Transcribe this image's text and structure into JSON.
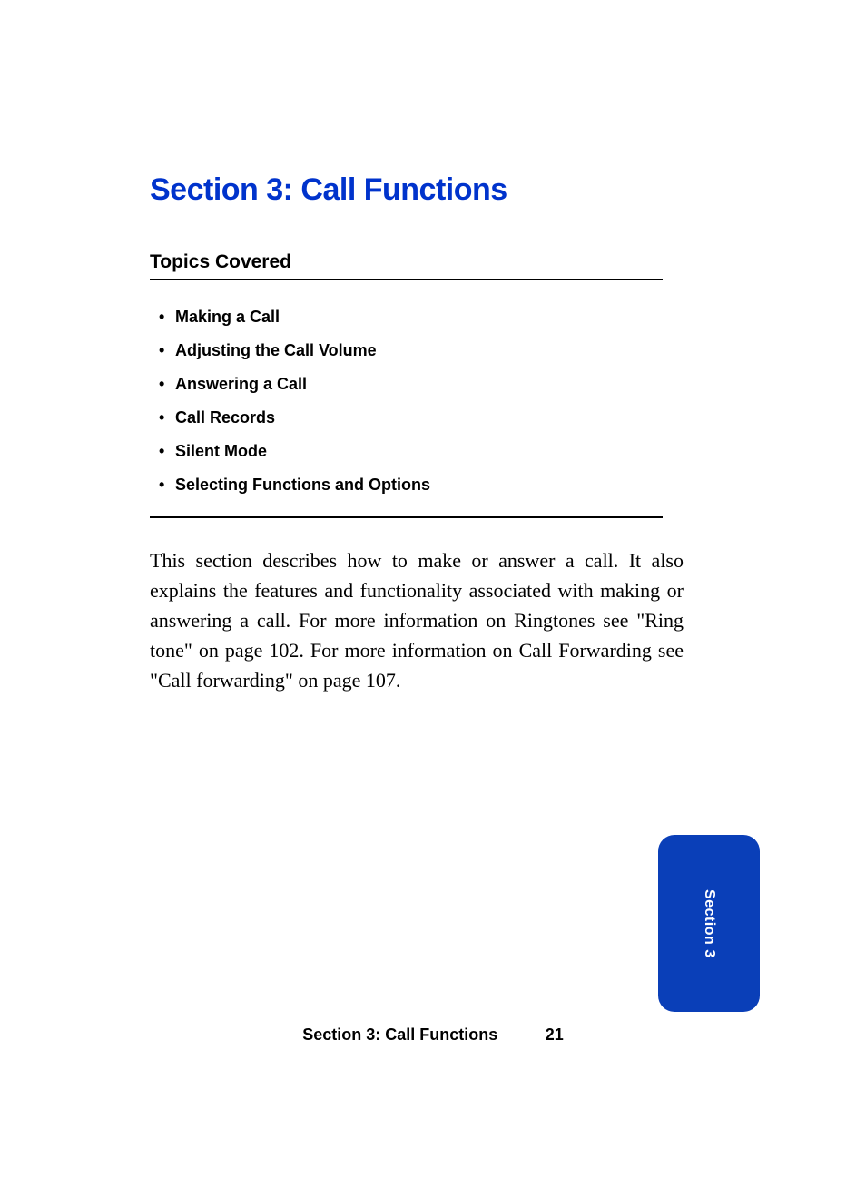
{
  "section_title": "Section 3: Call Functions",
  "topics_heading": "Topics Covered",
  "topics": [
    "Making a Call",
    "Adjusting the Call Volume",
    "Answering a Call",
    "Call Records",
    "Silent Mode",
    "Selecting Functions and Options"
  ],
  "body_paragraph": "This section describes how to make or answer a call. It also explains the features and functionality associated with making or answering a call. For more information on Ringtones see \"Ring tone\" on page 102. For more information on Call Forwarding see \"Call forwarding\" on page 107.",
  "tab_label": "Section 3",
  "footer": {
    "label": "Section 3: Call Functions",
    "page_number": "21"
  }
}
